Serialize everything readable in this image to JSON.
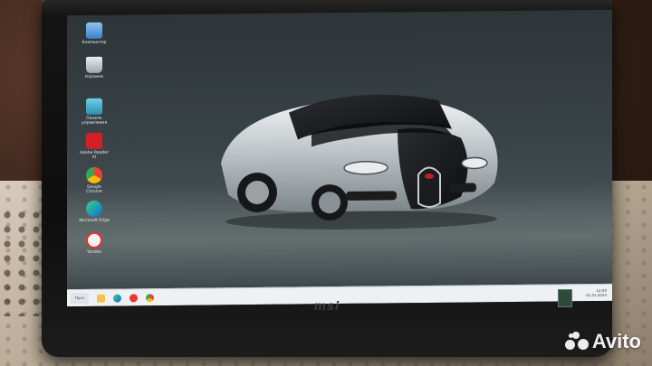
{
  "desktop": {
    "icons": [
      {
        "label": "Компьютер",
        "icon": "computer-icon"
      },
      {
        "label": "Корзина",
        "icon": "recycle-bin-icon"
      },
      {
        "label": "Панель\nуправления",
        "icon": "control-panel-icon"
      },
      {
        "label": "Adobe Reader\nXI",
        "icon": "adobe-reader-icon"
      },
      {
        "label": "Google\nChrome",
        "icon": "chrome-icon"
      },
      {
        "label": "Microsoft Edge",
        "icon": "edge-icon"
      },
      {
        "label": "Yandex",
        "icon": "yandex-icon"
      }
    ]
  },
  "monitor": {
    "brand": "msi"
  },
  "taskbar": {
    "start_label": "Пуск",
    "pinned": [
      "file-explorer-icon",
      "edge-icon",
      "yandex-icon",
      "chrome-icon"
    ],
    "tray_time": "12:00",
    "tray_date": "01.01.2024"
  },
  "watermark": {
    "text": "Avito"
  },
  "colors": {
    "wallpaper": "#394348",
    "taskbar": "#eef1f4",
    "bezel": "#151515"
  }
}
